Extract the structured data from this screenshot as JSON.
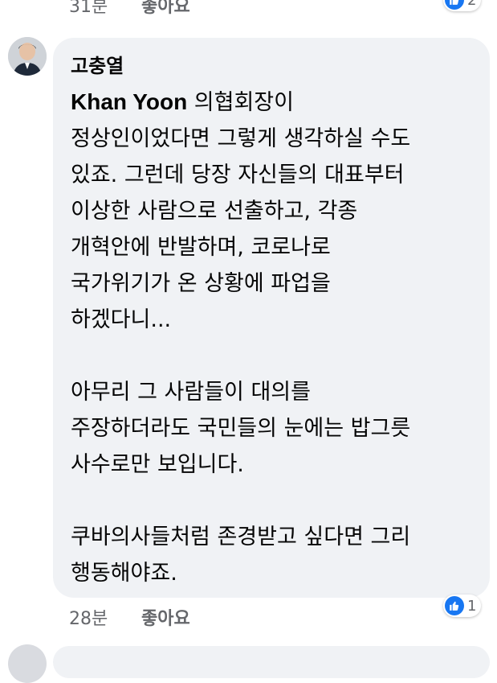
{
  "previous_comment": {
    "time": "31분",
    "like_label": "좋아요",
    "reaction_count": "2"
  },
  "comment": {
    "author": "고충열",
    "mention": "Khan Yoon",
    "text_first_line_rest": " 의협회장이",
    "text": "정상인이었다면 그렇게 생각하실 수도\n있죠. 그런데 당장 자신들의 대표부터\n이상한 사람으로 선출하고, 각종\n개혁안에 반발하며, 코로나로\n국가위기가 온 상황에 파업을\n하겠다니...\n\n아무리 그 사람들이 대의를\n주장하더라도 국민들의 눈에는 밥그릇\n사수로만 보입니다.\n\n쿠바의사들처럼 존경받고 싶다면 그리\n행동해야죠.",
    "time": "28분",
    "like_label": "좋아요",
    "reaction_count": "1"
  },
  "colors": {
    "bubble_bg": "#f0f2f5",
    "meta_text": "#65676b",
    "like_blue": "#1877f2"
  },
  "icons": {
    "reaction": "thumbs-up-icon"
  }
}
